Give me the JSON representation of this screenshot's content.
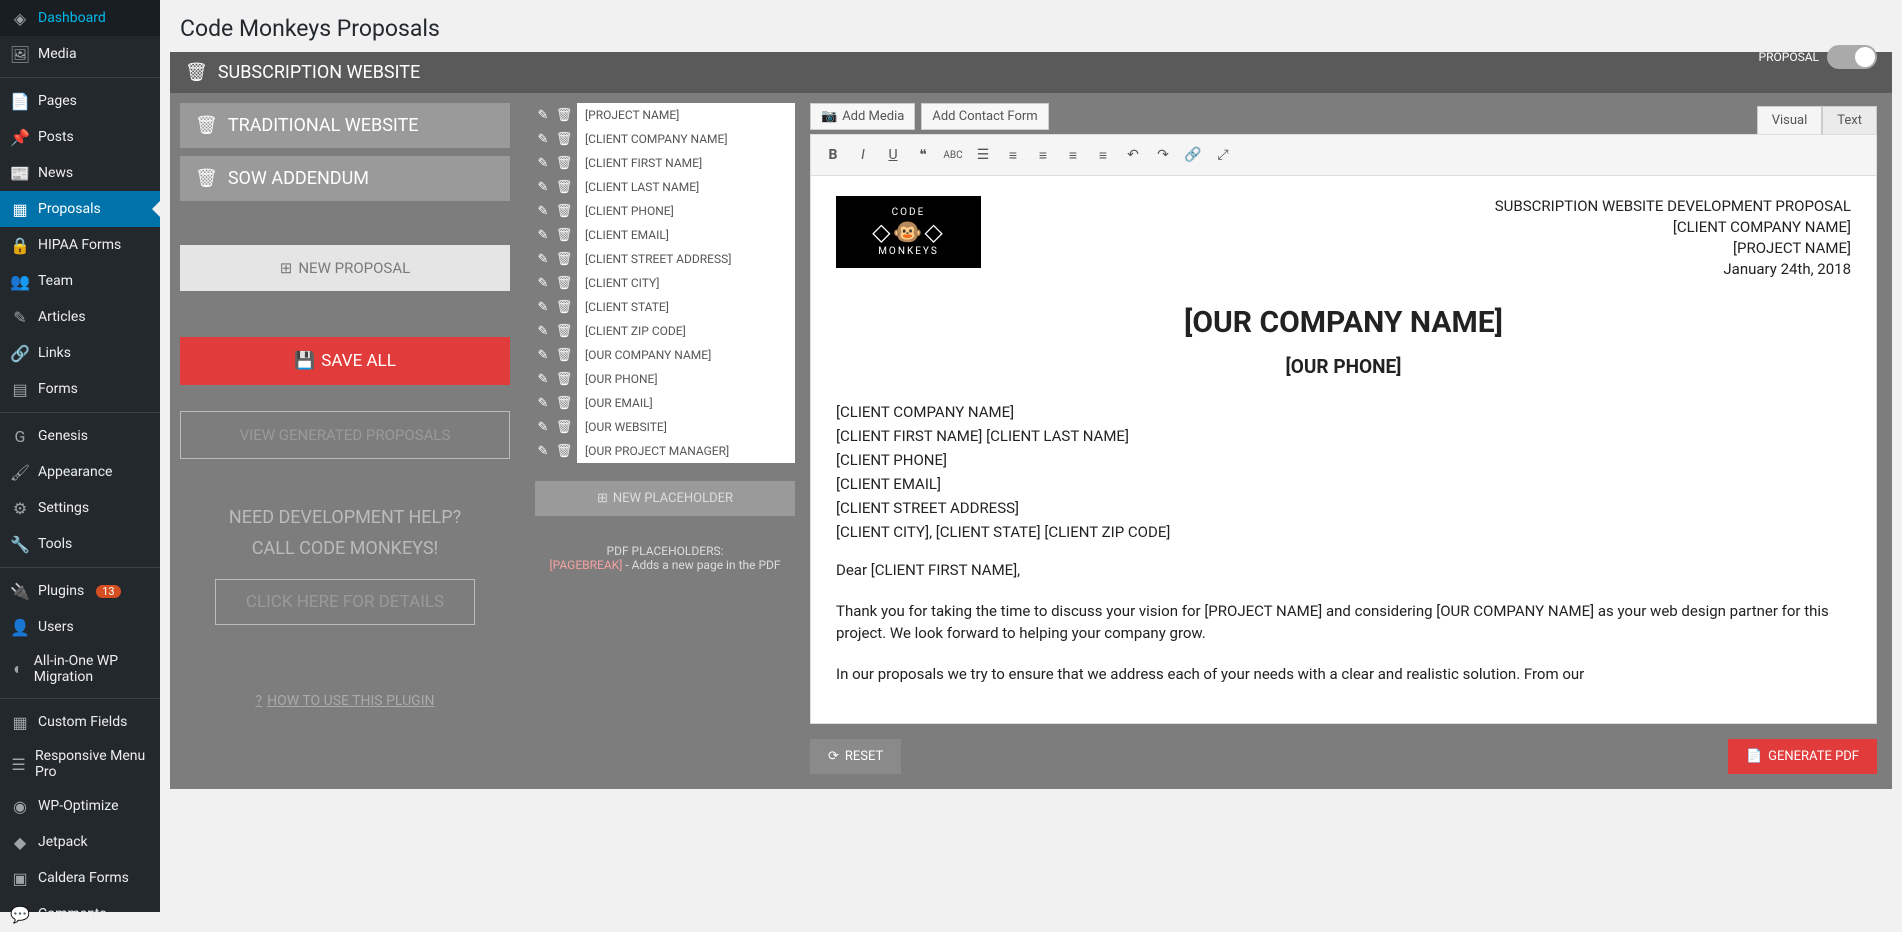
{
  "page_title": "Code Monkeys Proposals",
  "sidebar": [
    {
      "icon": "◈",
      "label": "Dashboard"
    },
    {
      "icon": "🖼",
      "label": "Media"
    },
    {
      "sep": true
    },
    {
      "icon": "📄",
      "label": "Pages"
    },
    {
      "icon": "📌",
      "label": "Posts"
    },
    {
      "icon": "📰",
      "label": "News"
    },
    {
      "icon": "▦",
      "label": "Proposals",
      "active": true
    },
    {
      "icon": "🔒",
      "label": "HIPAA Forms"
    },
    {
      "icon": "👥",
      "label": "Team"
    },
    {
      "icon": "✎",
      "label": "Articles"
    },
    {
      "icon": "🔗",
      "label": "Links"
    },
    {
      "icon": "▤",
      "label": "Forms"
    },
    {
      "sep": true
    },
    {
      "icon": "G",
      "label": "Genesis"
    },
    {
      "icon": "🖌",
      "label": "Appearance"
    },
    {
      "icon": "⚙",
      "label": "Settings"
    },
    {
      "icon": "🔧",
      "label": "Tools"
    },
    {
      "sep": true
    },
    {
      "icon": "🔌",
      "label": "Plugins",
      "badge": "13"
    },
    {
      "icon": "👤",
      "label": "Users"
    },
    {
      "icon": "◐",
      "label": "All-in-One WP Migration"
    },
    {
      "sep": true
    },
    {
      "icon": "▦",
      "label": "Custom Fields"
    },
    {
      "icon": "☰",
      "label": "Responsive Menu Pro"
    },
    {
      "icon": "◉",
      "label": "WP-Optimize"
    },
    {
      "icon": "◆",
      "label": "Jetpack"
    },
    {
      "icon": "▣",
      "label": "Caldera Forms"
    },
    {
      "icon": "💬",
      "label": "Comments"
    }
  ],
  "top_template": "SUBSCRIPTION WEBSITE",
  "templates": [
    "TRADITIONAL WEBSITE",
    "SOW ADDENDUM"
  ],
  "buttons": {
    "new_proposal": "NEW PROPOSAL",
    "save_all": "SAVE ALL",
    "view_generated": "VIEW GENERATED PROPOSALS",
    "help1": "NEED DEVELOPMENT HELP?",
    "help2": "CALL CODE MONKEYS!",
    "details": "CLICK HERE FOR DETAILS",
    "howto": "HOW TO USE THIS PLUGIN",
    "new_placeholder": "NEW PLACEHOLDER",
    "reset": "RESET",
    "generate": "GENERATE PDF",
    "add_media": "Add Media",
    "add_contact": "Add Contact Form",
    "toggle": "PROPOSAL"
  },
  "placeholders": [
    "[PROJECT NAME]",
    "[CLIENT COMPANY NAME]",
    "[CLIENT FIRST NAME]",
    "[CLIENT LAST NAME]",
    "[CLIENT PHONE]",
    "[CLIENT EMAIL]",
    "[CLIENT STREET ADDRESS]",
    "[CLIENT CITY]",
    "[CLIENT STATE]",
    "[CLIENT ZIP CODE]",
    "[OUR COMPANY NAME]",
    "[OUR PHONE]",
    "[OUR EMAIL]",
    "[OUR WEBSITE]",
    "[OUR PROJECT MANAGER]"
  ],
  "pdf_note_title": "PDF PLACEHOLDERS:",
  "pdf_note_tag": "[PAGEBREAK]",
  "pdf_note_text": " - Adds a new page in the PDF",
  "tabs": {
    "visual": "Visual",
    "text": "Text"
  },
  "doc": {
    "h_title": "SUBSCRIPTION WEBSITE DEVELOPMENT PROPOSAL",
    "h_company": "[CLIENT COMPANY NAME]",
    "h_project": "[PROJECT NAME]",
    "h_date": "January 24th, 2018",
    "h1": "[OUR COMPANY NAME]",
    "h2": "[OUR PHONE]",
    "lines": [
      "[CLIENT COMPANY NAME]",
      "[CLIENT FIRST NAME] [CLIENT LAST NAME]",
      "[CLIENT PHONE]",
      "[CLIENT EMAIL]",
      "[CLIENT STREET ADDRESS]",
      "[CLIENT CITY], [CLIENT STATE] [CLIENT ZIP CODE]"
    ],
    "dear": "Dear [CLIENT FIRST NAME],",
    "p1": "Thank you for taking the time to discuss your vision for [PROJECT NAME] and considering [OUR COMPANY NAME] as your web design partner for this project. We look forward to helping your company grow.",
    "p2": "In our proposals we try to ensure that we address each of your needs with a clear and realistic solution. From our"
  },
  "logo": {
    "top": "CODE",
    "bottom": "MONKEYS"
  }
}
